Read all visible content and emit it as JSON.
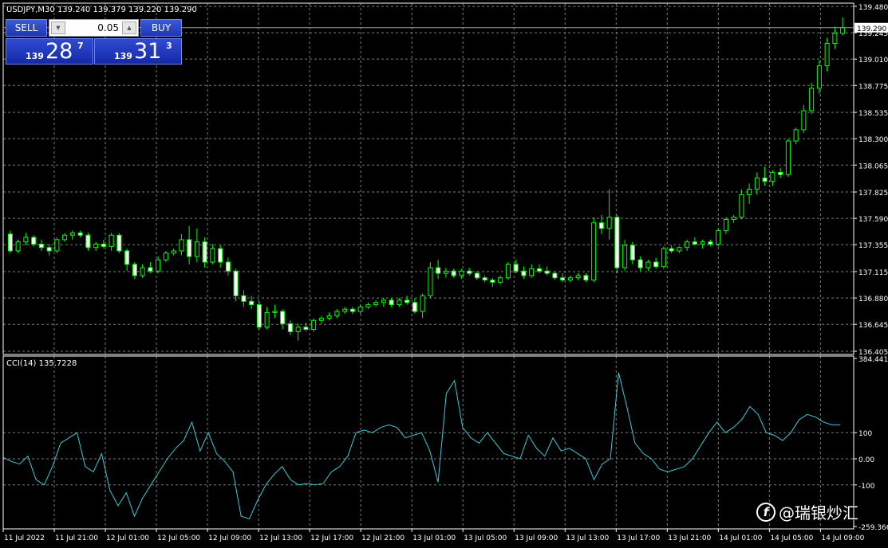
{
  "chart": {
    "symbol_line": "USDJPY,M30  139.240 139.379 139.220 139.290",
    "price_ticks": [
      "139.480",
      "139.245",
      "139.010",
      "138.775",
      "138.535",
      "138.300",
      "138.065",
      "137.825",
      "137.590",
      "137.355",
      "137.115",
      "136.880",
      "136.645",
      "136.405"
    ],
    "current_price_label": "139.290",
    "current_price": 139.29,
    "cci_label": "CCI(14) 135.7228",
    "cci_ticks": [
      "384.441",
      "100",
      "0.00",
      "-100",
      "-259.366"
    ],
    "time_ticks": [
      "11 Jul 2022",
      "11 Jul 21:00",
      "12 Jul 01:00",
      "12 Jul 05:00",
      "12 Jul 09:00",
      "12 Jul 13:00",
      "12 Jul 17:00",
      "12 Jul 21:00",
      "13 Jul 01:00",
      "13 Jul 05:00",
      "13 Jul 09:00",
      "13 Jul 13:00",
      "13 Jul 17:00",
      "13 Jul 21:00",
      "14 Jul 01:00",
      "14 Jul 05:00",
      "14 Jul 09:00"
    ],
    "colors": {
      "background": "#000000",
      "grid": "#7b7b7b",
      "candle": "#00ff00",
      "bull_body": "#000000",
      "bear_body": "#ffffff",
      "cci_line": "#3ec8d9",
      "text": "#ffffff"
    }
  },
  "trade_panel": {
    "sell_label": "SELL",
    "buy_label": "BUY",
    "lot_value": "0.05",
    "bid_small": "139",
    "bid_big": "28",
    "bid_sup": "7",
    "ask_small": "139",
    "ask_big": "31",
    "ask_sup": "3"
  },
  "watermark": {
    "icon_letter": "f",
    "text": "@瑞银炒汇"
  },
  "chart_data": {
    "type": "candlestick",
    "title": "USDJPY,M30",
    "price_ylim": [
      136.405,
      139.48
    ],
    "candles": [
      {
        "o": 137.45,
        "h": 137.48,
        "l": 137.28,
        "c": 137.3
      },
      {
        "o": 137.3,
        "h": 137.4,
        "l": 137.28,
        "c": 137.38
      },
      {
        "o": 137.38,
        "h": 137.46,
        "l": 137.35,
        "c": 137.42
      },
      {
        "o": 137.42,
        "h": 137.44,
        "l": 137.34,
        "c": 137.36
      },
      {
        "o": 137.36,
        "h": 137.4,
        "l": 137.3,
        "c": 137.33
      },
      {
        "o": 137.33,
        "h": 137.36,
        "l": 137.26,
        "c": 137.3
      },
      {
        "o": 137.3,
        "h": 137.42,
        "l": 137.28,
        "c": 137.4
      },
      {
        "o": 137.4,
        "h": 137.46,
        "l": 137.38,
        "c": 137.44
      },
      {
        "o": 137.44,
        "h": 137.48,
        "l": 137.4,
        "c": 137.46
      },
      {
        "o": 137.46,
        "h": 137.48,
        "l": 137.42,
        "c": 137.44
      },
      {
        "o": 137.44,
        "h": 137.46,
        "l": 137.3,
        "c": 137.33
      },
      {
        "o": 137.33,
        "h": 137.38,
        "l": 137.3,
        "c": 137.36
      },
      {
        "o": 137.36,
        "h": 137.4,
        "l": 137.32,
        "c": 137.34
      },
      {
        "o": 137.34,
        "h": 137.46,
        "l": 137.3,
        "c": 137.44
      },
      {
        "o": 137.44,
        "h": 137.46,
        "l": 137.28,
        "c": 137.3
      },
      {
        "o": 137.3,
        "h": 137.32,
        "l": 137.12,
        "c": 137.18
      },
      {
        "o": 137.18,
        "h": 137.2,
        "l": 137.05,
        "c": 137.08
      },
      {
        "o": 137.08,
        "h": 137.18,
        "l": 137.06,
        "c": 137.15
      },
      {
        "o": 137.15,
        "h": 137.2,
        "l": 137.1,
        "c": 137.12
      },
      {
        "o": 137.12,
        "h": 137.25,
        "l": 137.1,
        "c": 137.22
      },
      {
        "o": 137.22,
        "h": 137.3,
        "l": 137.2,
        "c": 137.28
      },
      {
        "o": 137.28,
        "h": 137.32,
        "l": 137.26,
        "c": 137.3
      },
      {
        "o": 137.3,
        "h": 137.45,
        "l": 137.26,
        "c": 137.4
      },
      {
        "o": 137.4,
        "h": 137.52,
        "l": 137.18,
        "c": 137.25
      },
      {
        "o": 137.25,
        "h": 137.5,
        "l": 137.2,
        "c": 137.38
      },
      {
        "o": 137.38,
        "h": 137.42,
        "l": 137.15,
        "c": 137.2
      },
      {
        "o": 137.2,
        "h": 137.36,
        "l": 137.18,
        "c": 137.32
      },
      {
        "o": 137.32,
        "h": 137.35,
        "l": 137.15,
        "c": 137.2
      },
      {
        "o": 137.2,
        "h": 137.24,
        "l": 137.08,
        "c": 137.12
      },
      {
        "o": 137.12,
        "h": 137.14,
        "l": 136.85,
        "c": 136.9
      },
      {
        "o": 136.9,
        "h": 136.95,
        "l": 136.8,
        "c": 136.85
      },
      {
        "o": 136.85,
        "h": 136.9,
        "l": 136.78,
        "c": 136.82
      },
      {
        "o": 136.82,
        "h": 136.85,
        "l": 136.6,
        "c": 136.62
      },
      {
        "o": 136.62,
        "h": 136.8,
        "l": 136.6,
        "c": 136.75
      },
      {
        "o": 136.75,
        "h": 136.82,
        "l": 136.7,
        "c": 136.76
      },
      {
        "o": 136.76,
        "h": 136.78,
        "l": 136.6,
        "c": 136.65
      },
      {
        "o": 136.65,
        "h": 136.68,
        "l": 136.55,
        "c": 136.58
      },
      {
        "o": 136.58,
        "h": 136.65,
        "l": 136.5,
        "c": 136.62
      },
      {
        "o": 136.62,
        "h": 136.66,
        "l": 136.58,
        "c": 136.6
      },
      {
        "o": 136.6,
        "h": 136.7,
        "l": 136.58,
        "c": 136.68
      },
      {
        "o": 136.68,
        "h": 136.72,
        "l": 136.65,
        "c": 136.7
      },
      {
        "o": 136.7,
        "h": 136.75,
        "l": 136.68,
        "c": 136.72
      },
      {
        "o": 136.72,
        "h": 136.78,
        "l": 136.7,
        "c": 136.76
      },
      {
        "o": 136.76,
        "h": 136.8,
        "l": 136.74,
        "c": 136.78
      },
      {
        "o": 136.78,
        "h": 136.8,
        "l": 136.74,
        "c": 136.76
      },
      {
        "o": 136.76,
        "h": 136.82,
        "l": 136.74,
        "c": 136.8
      },
      {
        "o": 136.8,
        "h": 136.84,
        "l": 136.78,
        "c": 136.82
      },
      {
        "o": 136.82,
        "h": 136.86,
        "l": 136.8,
        "c": 136.84
      },
      {
        "o": 136.84,
        "h": 136.88,
        "l": 136.8,
        "c": 136.86
      },
      {
        "o": 136.86,
        "h": 136.88,
        "l": 136.8,
        "c": 136.82
      },
      {
        "o": 136.82,
        "h": 136.88,
        "l": 136.8,
        "c": 136.86
      },
      {
        "o": 136.86,
        "h": 136.9,
        "l": 136.82,
        "c": 136.84
      },
      {
        "o": 136.84,
        "h": 136.88,
        "l": 136.74,
        "c": 136.76
      },
      {
        "o": 136.76,
        "h": 136.92,
        "l": 136.7,
        "c": 136.9
      },
      {
        "o": 136.9,
        "h": 137.2,
        "l": 136.88,
        "c": 137.15
      },
      {
        "o": 137.15,
        "h": 137.22,
        "l": 137.05,
        "c": 137.1
      },
      {
        "o": 137.1,
        "h": 137.15,
        "l": 137.06,
        "c": 137.12
      },
      {
        "o": 137.12,
        "h": 137.14,
        "l": 137.06,
        "c": 137.08
      },
      {
        "o": 137.08,
        "h": 137.14,
        "l": 137.05,
        "c": 137.12
      },
      {
        "o": 137.12,
        "h": 137.15,
        "l": 137.08,
        "c": 137.1
      },
      {
        "o": 137.1,
        "h": 137.12,
        "l": 137.04,
        "c": 137.06
      },
      {
        "o": 137.06,
        "h": 137.08,
        "l": 137.02,
        "c": 137.04
      },
      {
        "o": 137.04,
        "h": 137.06,
        "l": 136.98,
        "c": 137.02
      },
      {
        "o": 137.02,
        "h": 137.08,
        "l": 137.0,
        "c": 137.06
      },
      {
        "o": 137.06,
        "h": 137.2,
        "l": 137.04,
        "c": 137.18
      },
      {
        "o": 137.18,
        "h": 137.22,
        "l": 137.1,
        "c": 137.12
      },
      {
        "o": 137.12,
        "h": 137.16,
        "l": 137.05,
        "c": 137.08
      },
      {
        "o": 137.08,
        "h": 137.18,
        "l": 137.06,
        "c": 137.14
      },
      {
        "o": 137.14,
        "h": 137.18,
        "l": 137.1,
        "c": 137.12
      },
      {
        "o": 137.12,
        "h": 137.16,
        "l": 137.08,
        "c": 137.1
      },
      {
        "o": 137.1,
        "h": 137.12,
        "l": 137.04,
        "c": 137.06
      },
      {
        "o": 137.06,
        "h": 137.1,
        "l": 137.02,
        "c": 137.04
      },
      {
        "o": 137.04,
        "h": 137.08,
        "l": 137.02,
        "c": 137.06
      },
      {
        "o": 137.06,
        "h": 137.1,
        "l": 137.04,
        "c": 137.08
      },
      {
        "o": 137.08,
        "h": 137.1,
        "l": 137.02,
        "c": 137.04
      },
      {
        "o": 137.04,
        "h": 137.6,
        "l": 137.02,
        "c": 137.55
      },
      {
        "o": 137.55,
        "h": 137.62,
        "l": 137.45,
        "c": 137.5
      },
      {
        "o": 137.5,
        "h": 137.85,
        "l": 137.4,
        "c": 137.6
      },
      {
        "o": 137.6,
        "h": 137.62,
        "l": 137.1,
        "c": 137.15
      },
      {
        "o": 137.15,
        "h": 137.4,
        "l": 137.12,
        "c": 137.35
      },
      {
        "o": 137.35,
        "h": 137.38,
        "l": 137.18,
        "c": 137.22
      },
      {
        "o": 137.22,
        "h": 137.25,
        "l": 137.12,
        "c": 137.15
      },
      {
        "o": 137.15,
        "h": 137.22,
        "l": 137.12,
        "c": 137.2
      },
      {
        "o": 137.2,
        "h": 137.24,
        "l": 137.14,
        "c": 137.16
      },
      {
        "o": 137.16,
        "h": 137.34,
        "l": 137.14,
        "c": 137.32
      },
      {
        "o": 137.32,
        "h": 137.35,
        "l": 137.28,
        "c": 137.3
      },
      {
        "o": 137.3,
        "h": 137.34,
        "l": 137.28,
        "c": 137.33
      },
      {
        "o": 137.33,
        "h": 137.4,
        "l": 137.3,
        "c": 137.38
      },
      {
        "o": 137.38,
        "h": 137.42,
        "l": 137.35,
        "c": 137.36
      },
      {
        "o": 137.36,
        "h": 137.4,
        "l": 137.32,
        "c": 137.38
      },
      {
        "o": 137.38,
        "h": 137.4,
        "l": 137.34,
        "c": 137.36
      },
      {
        "o": 137.36,
        "h": 137.5,
        "l": 137.34,
        "c": 137.48
      },
      {
        "o": 137.48,
        "h": 137.6,
        "l": 137.45,
        "c": 137.58
      },
      {
        "o": 137.58,
        "h": 137.62,
        "l": 137.55,
        "c": 137.6
      },
      {
        "o": 137.6,
        "h": 137.85,
        "l": 137.58,
        "c": 137.8
      },
      {
        "o": 137.8,
        "h": 137.9,
        "l": 137.72,
        "c": 137.85
      },
      {
        "o": 137.85,
        "h": 138.0,
        "l": 137.8,
        "c": 137.95
      },
      {
        "o": 137.95,
        "h": 138.05,
        "l": 137.88,
        "c": 137.92
      },
      {
        "o": 137.92,
        "h": 138.02,
        "l": 137.88,
        "c": 138.0
      },
      {
        "o": 138.0,
        "h": 138.04,
        "l": 137.95,
        "c": 137.98
      },
      {
        "o": 137.98,
        "h": 138.3,
        "l": 137.96,
        "c": 138.28
      },
      {
        "o": 138.28,
        "h": 138.4,
        "l": 138.25,
        "c": 138.38
      },
      {
        "o": 138.38,
        "h": 138.6,
        "l": 138.35,
        "c": 138.55
      },
      {
        "o": 138.55,
        "h": 138.8,
        "l": 138.52,
        "c": 138.75
      },
      {
        "o": 138.75,
        "h": 139.0,
        "l": 138.7,
        "c": 138.95
      },
      {
        "o": 138.95,
        "h": 139.2,
        "l": 138.9,
        "c": 139.15
      },
      {
        "o": 139.15,
        "h": 139.3,
        "l": 139.1,
        "c": 139.24
      },
      {
        "o": 139.24,
        "h": 139.38,
        "l": 139.22,
        "c": 139.29
      }
    ],
    "cci": {
      "name": "CCI(14)",
      "ylim": [
        -259.366,
        384.441
      ],
      "levels": [
        100,
        0,
        -100
      ],
      "values": [
        5,
        -10,
        -20,
        10,
        -80,
        -100,
        -30,
        60,
        80,
        100,
        -30,
        -50,
        20,
        -120,
        -180,
        -130,
        -220,
        -150,
        -100,
        -50,
        0,
        40,
        70,
        140,
        30,
        100,
        20,
        -10,
        -50,
        -220,
        -230,
        -160,
        -100,
        -60,
        -30,
        -80,
        -100,
        -95,
        -100,
        -95,
        -50,
        -30,
        10,
        100,
        110,
        100,
        120,
        130,
        120,
        80,
        90,
        100,
        30,
        -90,
        250,
        300,
        120,
        80,
        60,
        100,
        60,
        20,
        10,
        0,
        90,
        40,
        10,
        80,
        30,
        40,
        20,
        0,
        -80,
        -20,
        0,
        330,
        200,
        60,
        20,
        0,
        -40,
        -50,
        -40,
        -30,
        0,
        50,
        100,
        140,
        100,
        120,
        150,
        200,
        170,
        100,
        90,
        70,
        100,
        150,
        170,
        160,
        140,
        130,
        130
      ]
    },
    "xlabel": "",
    "ylabel": ""
  }
}
